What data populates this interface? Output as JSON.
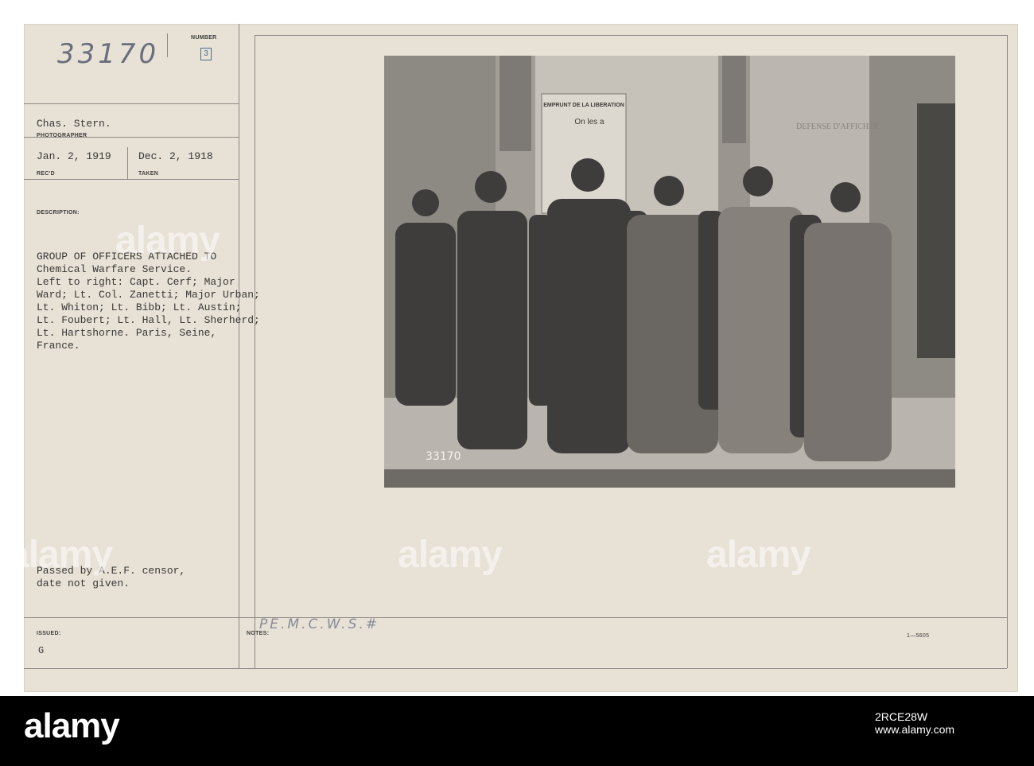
{
  "card": {
    "number_label": "NUMBER",
    "number_value": "33170",
    "number_stamp": "3",
    "photographer_name": "Chas. Stern.",
    "photographer_label": "PHOTOGRAPHER",
    "received_date": "Jan. 2, 1919",
    "received_label": "REC'D",
    "taken_date": "Dec. 2, 1918",
    "taken_label": "TAKEN",
    "description_label": "DESCRIPTION:",
    "description_text": "GROUP OF OFFICERS ATTACHED TO\nChemical Warfare Service.\nLeft to right: Capt. Cerf; Major\nWard; Lt. Col. Zanetti; Major Urban;\nLt. Whiton; Lt. Bibb; Lt. Austin;\nLt. Foubert; Lt. Hall, Lt. Sherherd;\nLt. Hartshorne. Paris, Seine,\nFrance.",
    "censor_text": "Passed by A.E.F. censor,\ndate not given.",
    "issued_label": "ISSUED:",
    "issued_value": "G",
    "notes_label": "NOTES:",
    "notes_value": "PE.M.C.W.S.#",
    "form_number": "1—5605"
  },
  "photo": {
    "poster_line1": "EMPRUNT DE LA LIBERATION",
    "poster_line2": "On les a",
    "wall_text": "DEFENSE D'AFFICHER",
    "negative_number": "33170"
  },
  "watermark": {
    "text": "alamy",
    "image_id": "2RCE28W",
    "site": "www.alamy.com"
  },
  "colors": {
    "card": "#e7e1d6",
    "bar": "#000000",
    "ink": "#3a3936"
  }
}
